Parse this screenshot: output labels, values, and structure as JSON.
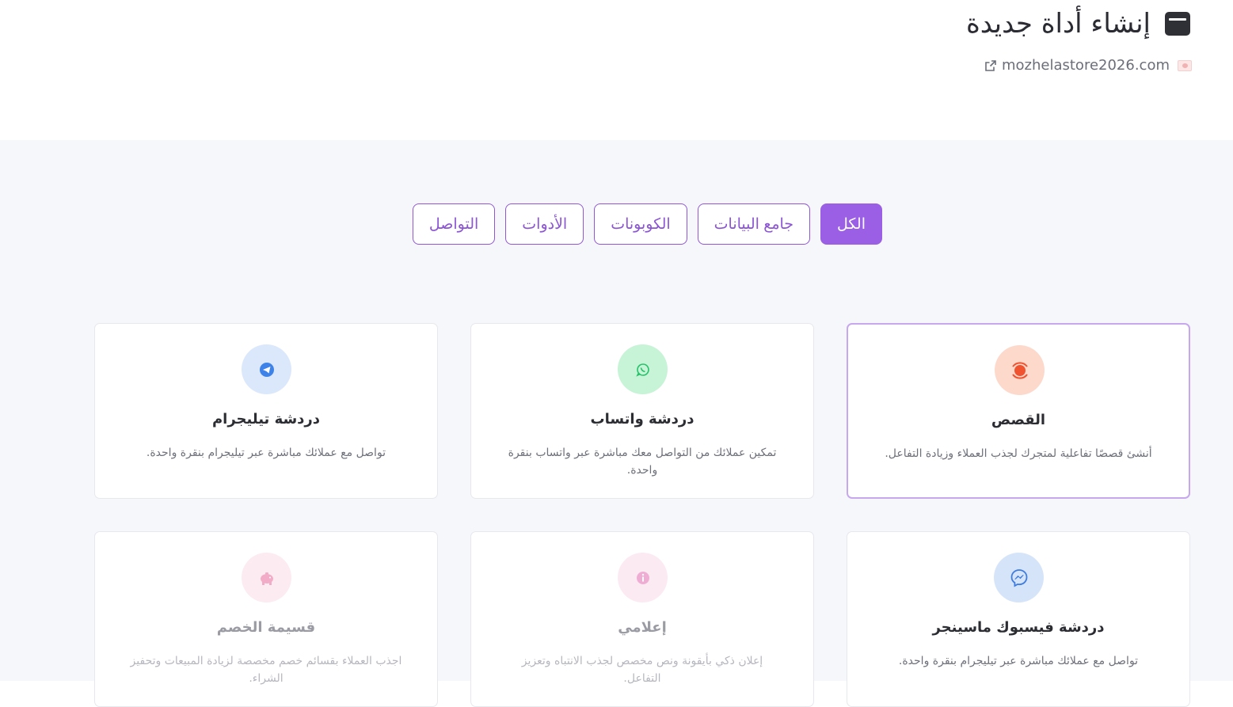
{
  "header": {
    "title": "إنشاء أداة جديدة",
    "site": "mozhelastore2026.com"
  },
  "filters": [
    {
      "label": "الكل",
      "active": true
    },
    {
      "label": "جامع البيانات",
      "active": false
    },
    {
      "label": "الكوبونات",
      "active": false
    },
    {
      "label": "الأدوات",
      "active": false
    },
    {
      "label": "التواصل",
      "active": false
    }
  ],
  "cards": [
    {
      "title": "القصص",
      "desc": "أنشئ قصصًا تفاعلية لمتجرك لجذب العملاء وزيادة التفاعل.",
      "icon": "stories-icon",
      "color": "#f0532f"
    },
    {
      "title": "دردشة واتساب",
      "desc": "تمكين عملائك من التواصل معك مباشرة عبر واتساب بنقرة واحدة.",
      "icon": "whatsapp-icon",
      "color": "#25c26a"
    },
    {
      "title": "دردشة تيليجرام",
      "desc": "تواصل مع عملائك مباشرة عبر تيليجرام بنقرة واحدة.",
      "icon": "telegram-icon",
      "color": "#3d82e8"
    },
    {
      "title": "دردشة فيسبوك ماسينجر",
      "desc": "تواصل مع عملائك مباشرة عبر تيليجرام بنقرة واحدة.",
      "icon": "messenger-icon",
      "color": "#3d7ce0"
    },
    {
      "title": "إعلامي",
      "desc": "إعلان ذكي بأيقونة ونص مخصص لجذب الانتباه وتعزيز التفاعل.",
      "icon": "info-icon",
      "color": "#e36bb2"
    },
    {
      "title": "قسيمة الخصم",
      "desc": "اجذب العملاء بقسائم خصم مخصصة لزيادة المبيعات وتحفيز الشراء.",
      "icon": "piggy-bank-icon",
      "color": "#ea6a9a"
    }
  ]
}
